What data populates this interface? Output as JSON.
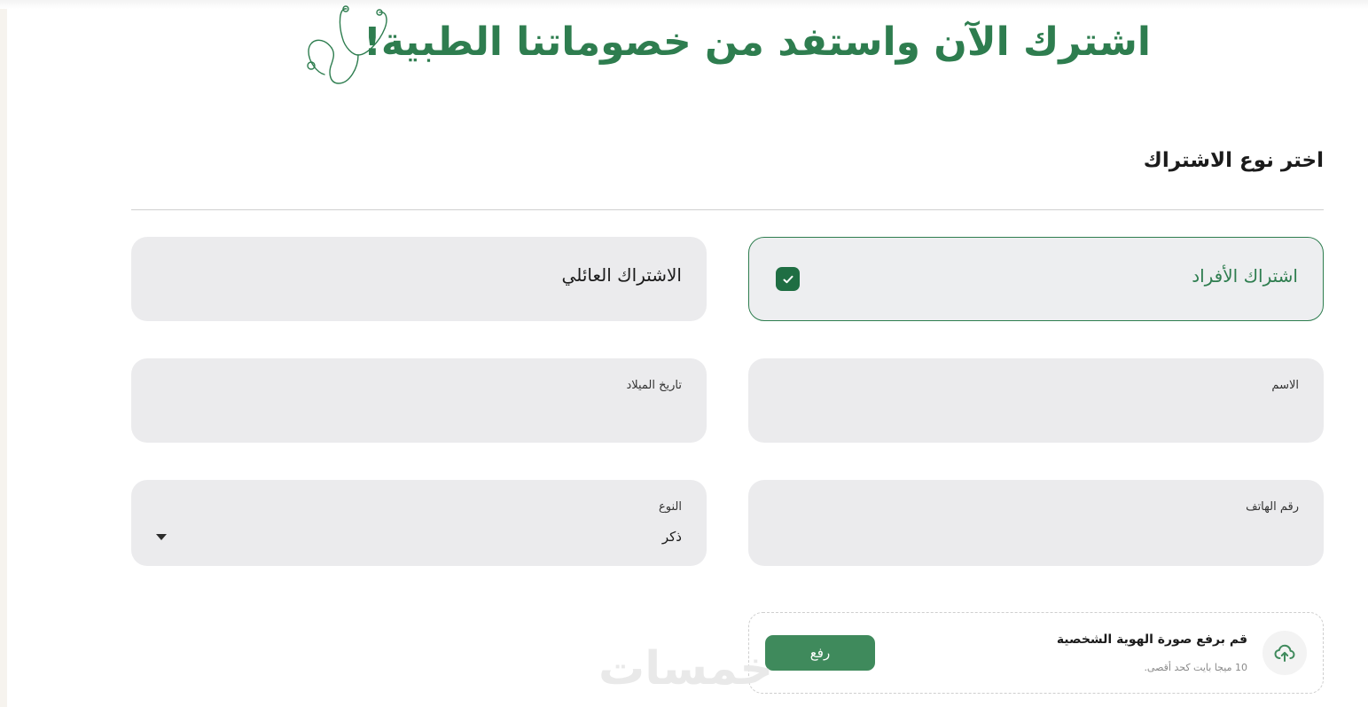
{
  "header": {
    "title": "اشترك الآن واستفد من خصوماتنا الطبية!",
    "illustration": "stethoscope-icon",
    "accent_color": "#2e7d4f"
  },
  "subscription": {
    "heading": "اختر نوع الاشتراك",
    "options": [
      {
        "label": "اشتراك الأفراد",
        "selected": true
      },
      {
        "label": "الاشتراك العائلي",
        "selected": false
      }
    ]
  },
  "form": {
    "name_label": "الاسم",
    "name_value": "",
    "birthdate_label": "تاريخ الميلاد",
    "birthdate_value": "",
    "phone_label": "رقم الهاتف",
    "phone_value": "",
    "gender_label": "النوع",
    "gender_value": "ذكر"
  },
  "upload": {
    "title": "قم برفع صورة الهوية الشخصية",
    "hint": "10 ميجا بايت كحد أقصى.",
    "button_label": "رفع"
  },
  "watermark": {
    "text": "خمسات"
  }
}
